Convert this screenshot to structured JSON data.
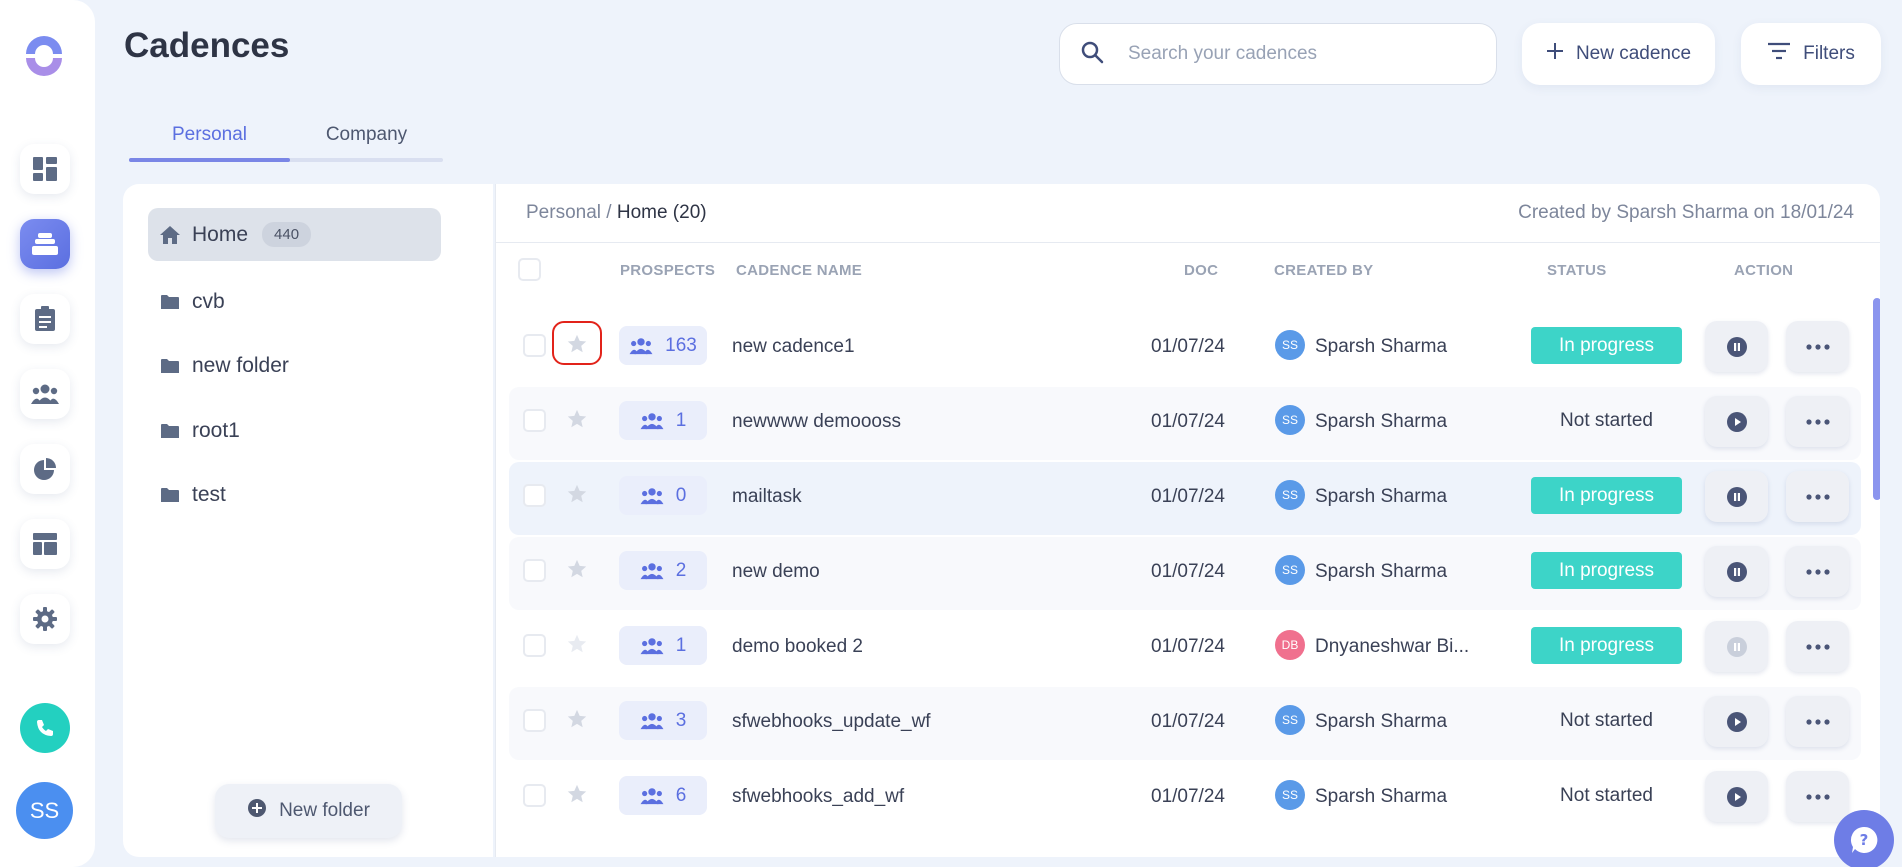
{
  "header": {
    "title": "Cadences",
    "search_placeholder": "Search your cadences",
    "new_cadence_label": "New cadence",
    "filters_label": "Filters"
  },
  "tabs": [
    {
      "label": "Personal",
      "active": true
    },
    {
      "label": "Company",
      "active": false
    }
  ],
  "rail": {
    "icons": [
      "logo-icon",
      "dashboard-icon",
      "cadences-icon",
      "tasks-icon",
      "people-icon",
      "reports-icon",
      "templates-icon",
      "settings-icon",
      "phone-icon"
    ],
    "user_initials": "SS"
  },
  "folders": {
    "items": [
      {
        "label": "Home",
        "count": "440",
        "icon": "home-icon",
        "active": true
      },
      {
        "label": "cvb",
        "icon": "folder-icon"
      },
      {
        "label": "new folder",
        "icon": "folder-icon"
      },
      {
        "label": "root1",
        "icon": "folder-icon"
      },
      {
        "label": "test",
        "icon": "folder-icon"
      }
    ],
    "new_folder_label": "New folder"
  },
  "main": {
    "breadcrumb_root": "Personal",
    "breadcrumb_sep": "/",
    "breadcrumb_current": "Home (20)",
    "created_info": "Created by Sparsh Sharma on 18/01/24",
    "columns": {
      "prospects": "PROSPECTS",
      "name": "CADENCE NAME",
      "doc": "DOC",
      "created_by": "CREATED BY",
      "status": "STATUS",
      "action": "ACTION"
    },
    "rows": [
      {
        "prospects": "163",
        "name": "new cadence1",
        "doc": "01/07/24",
        "initials": "SS",
        "created_by": "Sparsh Sharma",
        "status": "In progress"
      },
      {
        "prospects": "1",
        "name": "newwww demoooss",
        "doc": "01/07/24",
        "initials": "SS",
        "created_by": "Sparsh Sharma",
        "status": "Not started"
      },
      {
        "prospects": "0",
        "name": "mailtask",
        "doc": "01/07/24",
        "initials": "SS",
        "created_by": "Sparsh Sharma",
        "status": "In progress"
      },
      {
        "prospects": "2",
        "name": "new demo",
        "doc": "01/07/24",
        "initials": "SS",
        "created_by": "Sparsh Sharma",
        "status": "In progress"
      },
      {
        "prospects": "1",
        "name": "demo booked 2",
        "doc": "01/07/24",
        "initials": "DB",
        "created_by": "Dnyaneshwar Bi...",
        "status": "In progress"
      },
      {
        "prospects": "3",
        "name": "sfwebhooks_update_wf",
        "doc": "01/07/24",
        "initials": "SS",
        "created_by": "Sparsh Sharma",
        "status": "Not started"
      },
      {
        "prospects": "6",
        "name": "sfwebhooks_add_wf",
        "doc": "01/07/24",
        "initials": "SS",
        "created_by": "Sparsh Sharma",
        "status": "Not started"
      }
    ]
  },
  "colors": {
    "accent": "#5b6fe0",
    "in_progress": "#3dd4c8",
    "avatar_ss": "#5a9ae8",
    "avatar_db": "#f0708e",
    "call": "#23d0c0"
  }
}
